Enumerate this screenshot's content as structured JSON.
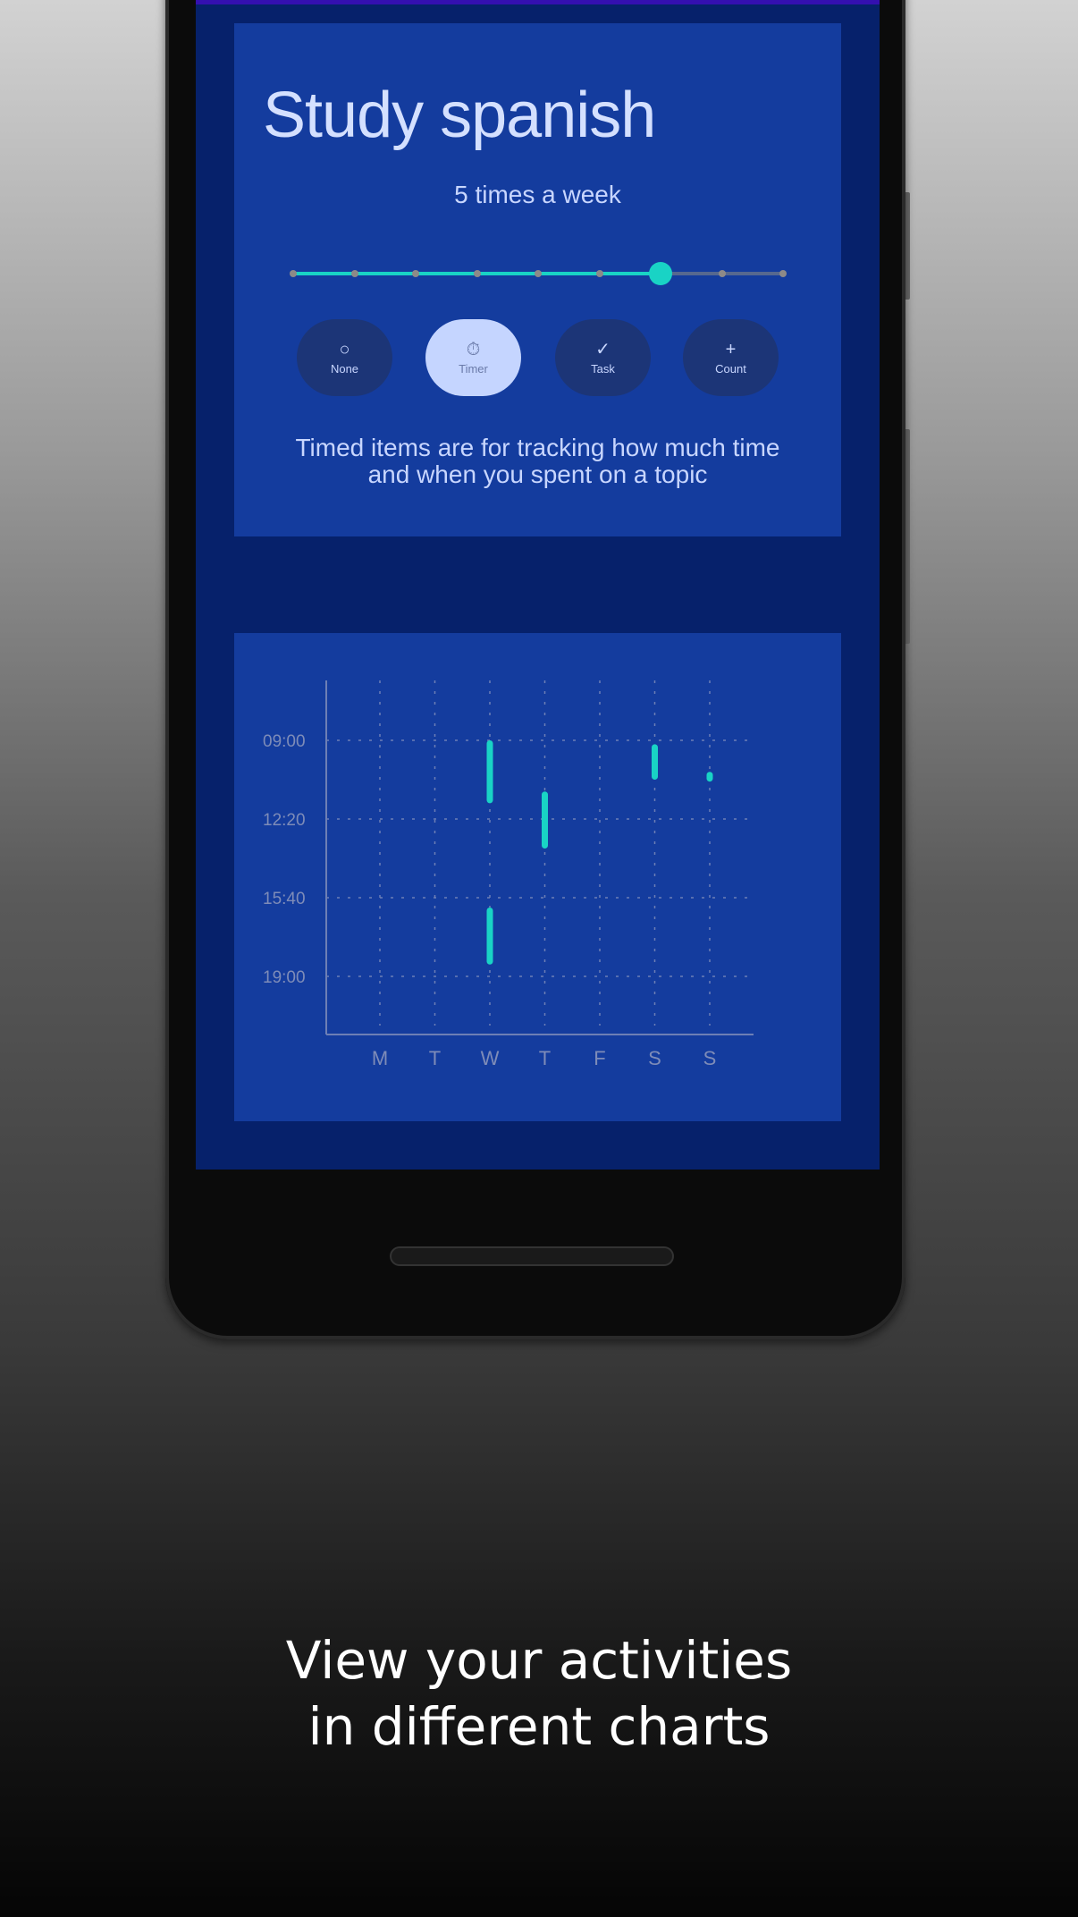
{
  "habit": {
    "title": "Study spanish",
    "frequency_label": "5 times a week",
    "frequency_slider": {
      "steps": 9,
      "selected_index": 6,
      "fraction": 0.75
    },
    "types": [
      {
        "label": "None",
        "icon": "circle-icon",
        "glyph": "○",
        "selected": false
      },
      {
        "label": "Timer",
        "icon": "stopwatch-icon",
        "glyph": "⏱",
        "selected": true
      },
      {
        "label": "Task",
        "icon": "check-circle-icon",
        "glyph": "✓",
        "selected": false
      },
      {
        "label": "Count",
        "icon": "plus-icon",
        "glyph": "+",
        "selected": false
      }
    ],
    "description_line1": "Timed items are for tracking how much time",
    "description_line2": "and when you spent on a topic"
  },
  "colors": {
    "screen": "#06216b",
    "card": "#143c9e",
    "accent": "#19d3c5"
  },
  "chart_data": {
    "type": "bar",
    "subtype": "floating-range",
    "categories": [
      "M",
      "T",
      "W",
      "T",
      "F",
      "S",
      "S"
    ],
    "y_tick_labels": [
      "09:00",
      "12:20",
      "15:40",
      "19:00"
    ],
    "ylim": [
      "06:30",
      "21:30"
    ],
    "y_inverted": true,
    "grid": true,
    "ranges": [
      {
        "day_index": 2,
        "start": "09:00",
        "end": "11:40"
      },
      {
        "day_index": 2,
        "start": "16:05",
        "end": "18:30"
      },
      {
        "day_index": 3,
        "start": "11:10",
        "end": "13:35"
      },
      {
        "day_index": 5,
        "start": "09:10",
        "end": "10:40"
      },
      {
        "day_index": 6,
        "start": "10:20",
        "end": "10:45"
      }
    ]
  },
  "caption": {
    "line1": "View your activities",
    "line2": "in different charts"
  }
}
